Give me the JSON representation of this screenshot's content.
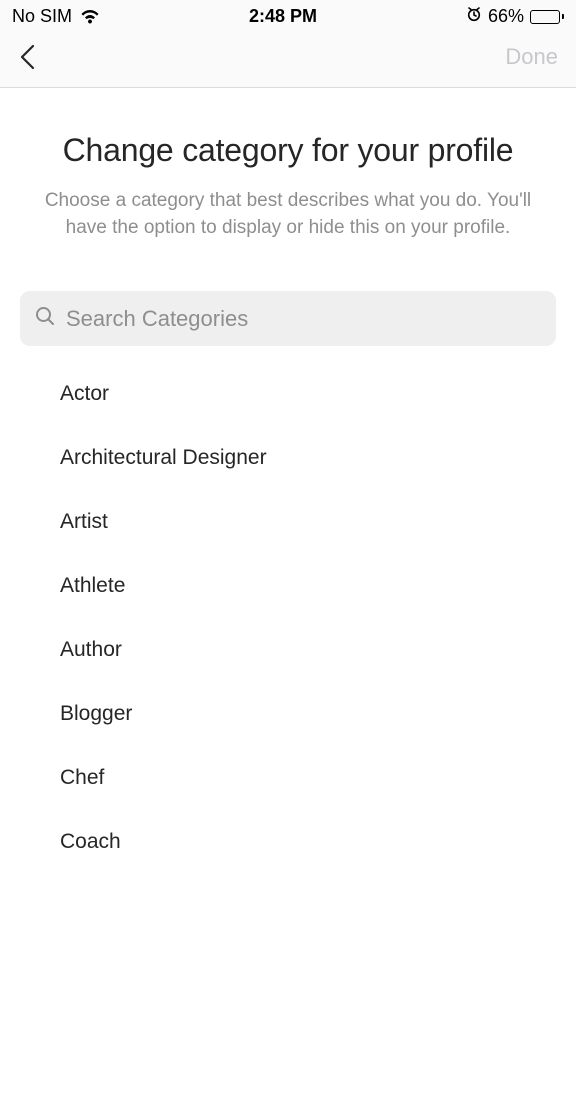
{
  "status": {
    "carrier": "No SIM",
    "time": "2:48 PM",
    "battery_pct": "66%"
  },
  "nav": {
    "done_label": "Done"
  },
  "header": {
    "title": "Change category for your profile",
    "subtitle": "Choose a category that best describes what you do. You'll have the option to display or hide this on your profile."
  },
  "search": {
    "placeholder": "Search Categories"
  },
  "categories": [
    "Actor",
    "Architectural Designer",
    "Artist",
    "Athlete",
    "Author",
    "Blogger",
    "Chef",
    "Coach"
  ]
}
